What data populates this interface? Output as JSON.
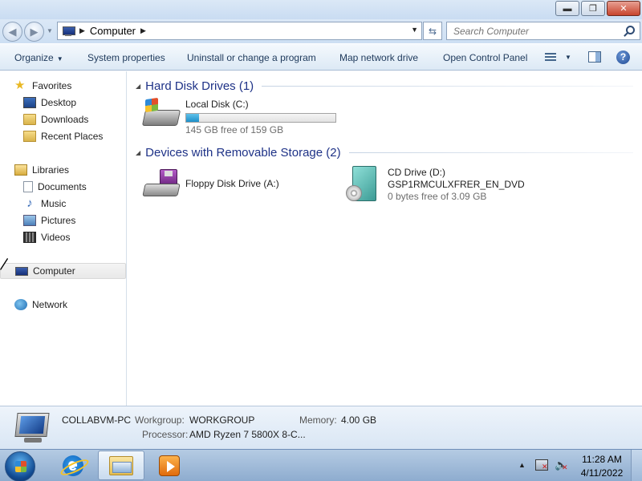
{
  "window": {
    "caption_minimize": "▬",
    "caption_maximize": "❐",
    "caption_close": "✕"
  },
  "address": {
    "breadcrumb_location": "Computer",
    "search_placeholder": "Search Computer"
  },
  "toolbar": {
    "organize": "Organize",
    "system_properties": "System properties",
    "uninstall": "Uninstall or change a program",
    "map_network_drive": "Map network drive",
    "open_control_panel": "Open Control Panel",
    "help_glyph": "?"
  },
  "navpane": {
    "favorites": "Favorites",
    "desktop": "Desktop",
    "downloads": "Downloads",
    "recent_places": "Recent Places",
    "libraries": "Libraries",
    "documents": "Documents",
    "music": "Music",
    "pictures": "Pictures",
    "videos": "Videos",
    "computer": "Computer",
    "network": "Network"
  },
  "content": {
    "hdd_group": "Hard Disk Drives (1)",
    "removable_group": "Devices with Removable Storage (2)",
    "local_disk": {
      "name": "Local Disk (C:)",
      "free": "145 GB free of 159 GB",
      "used_fraction": 0.088
    },
    "floppy": {
      "name": "Floppy Disk Drive (A:)"
    },
    "cd_drive": {
      "name": "CD Drive (D:)",
      "label": "GSP1RMCULXFRER_EN_DVD",
      "free": "0 bytes free of 3.09 GB"
    }
  },
  "details": {
    "computer_name": "COLLABVM-PC",
    "workgroup_label": "Workgroup:",
    "workgroup_value": "WORKGROUP",
    "memory_label": "Memory:",
    "memory_value": "4.00 GB",
    "processor_label": "Processor:",
    "processor_value": "AMD Ryzen 7 5800X 8-C..."
  },
  "taskbar": {
    "time": "11:28 AM",
    "date": "4/11/2022"
  }
}
